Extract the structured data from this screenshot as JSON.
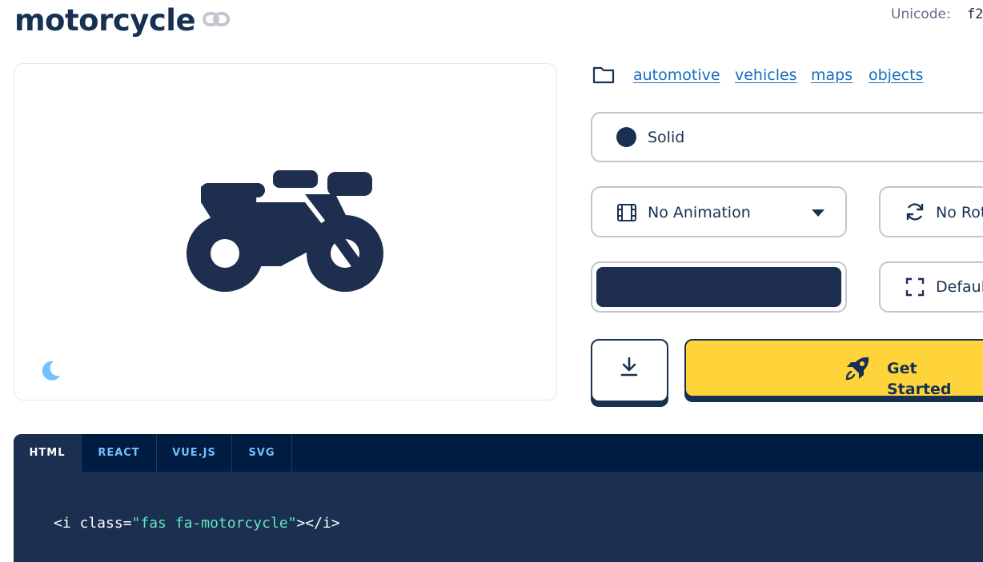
{
  "icon": {
    "name": "motorcycle",
    "unicode_label": "Unicode:",
    "unicode_value": "f2"
  },
  "categories": [
    "automotive",
    "vehicles",
    "maps",
    "objects"
  ],
  "style": {
    "label": "Solid"
  },
  "animation": {
    "label": "No Animation"
  },
  "rotation": {
    "label": "No Rot"
  },
  "size": {
    "label": "Defaul"
  },
  "color": {
    "swatch": "#1e2e4f"
  },
  "actions": {
    "get_started": "Get Started"
  },
  "code": {
    "tabs": [
      "HTML",
      "REACT",
      "VUE.JS",
      "SVG"
    ],
    "active_tab": "HTML",
    "snippet_prefix": "<i class=",
    "snippet_string": "\"fas fa-motorcycle\"",
    "snippet_suffix": "></i>"
  },
  "colors": {
    "navy": "#183153",
    "link": "#146ebe",
    "yellow": "#ffd43b",
    "code_bg": "#1b2f50",
    "tab_bg": "#001c40",
    "moon": "#74c0fc"
  }
}
